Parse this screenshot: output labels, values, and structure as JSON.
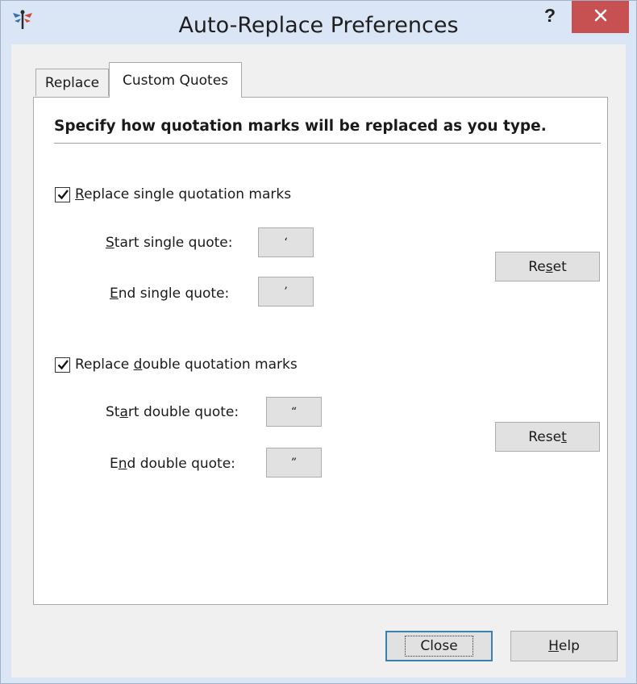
{
  "window": {
    "title": "Auto-Replace Preferences",
    "help_label": "?",
    "close_icon": "close-x-icon",
    "app_icon": "dragonfly-logo-icon",
    "colors": {
      "frame": "#dae6f5",
      "close_bg": "#c75050"
    }
  },
  "tabs": [
    {
      "label": "Replace",
      "active": false
    },
    {
      "label": "Custom Quotes",
      "active": true
    }
  ],
  "panel": {
    "heading": "Specify how quotation marks will be replaced as you type.",
    "single": {
      "checkbox_label_pre": "",
      "checkbox_label_mnemonic": "R",
      "checkbox_label_post": "eplace single quotation marks",
      "checked": true,
      "start_label_mnemonic": "S",
      "start_label_post": "tart single quote:",
      "start_value": "‘",
      "end_label_mnemonic": "E",
      "end_label_post": "nd single quote:",
      "end_value": "’",
      "reset_pre": "Re",
      "reset_mnemonic": "s",
      "reset_post": "et"
    },
    "double": {
      "checkbox_label_pre": "Replace ",
      "checkbox_label_mnemonic": "d",
      "checkbox_label_post": "ouble quotation marks",
      "checked": true,
      "start_label_pre": "St",
      "start_label_mnemonic": "a",
      "start_label_post": "rt double quote:",
      "start_value": "“",
      "end_label_pre": "E",
      "end_label_mnemonic": "n",
      "end_label_post": "d double quote:",
      "end_value": "”",
      "reset_pre": "Rese",
      "reset_mnemonic": "t",
      "reset_post": ""
    }
  },
  "footer": {
    "close_label": "Close",
    "help_mnemonic": "H",
    "help_post": "elp"
  }
}
